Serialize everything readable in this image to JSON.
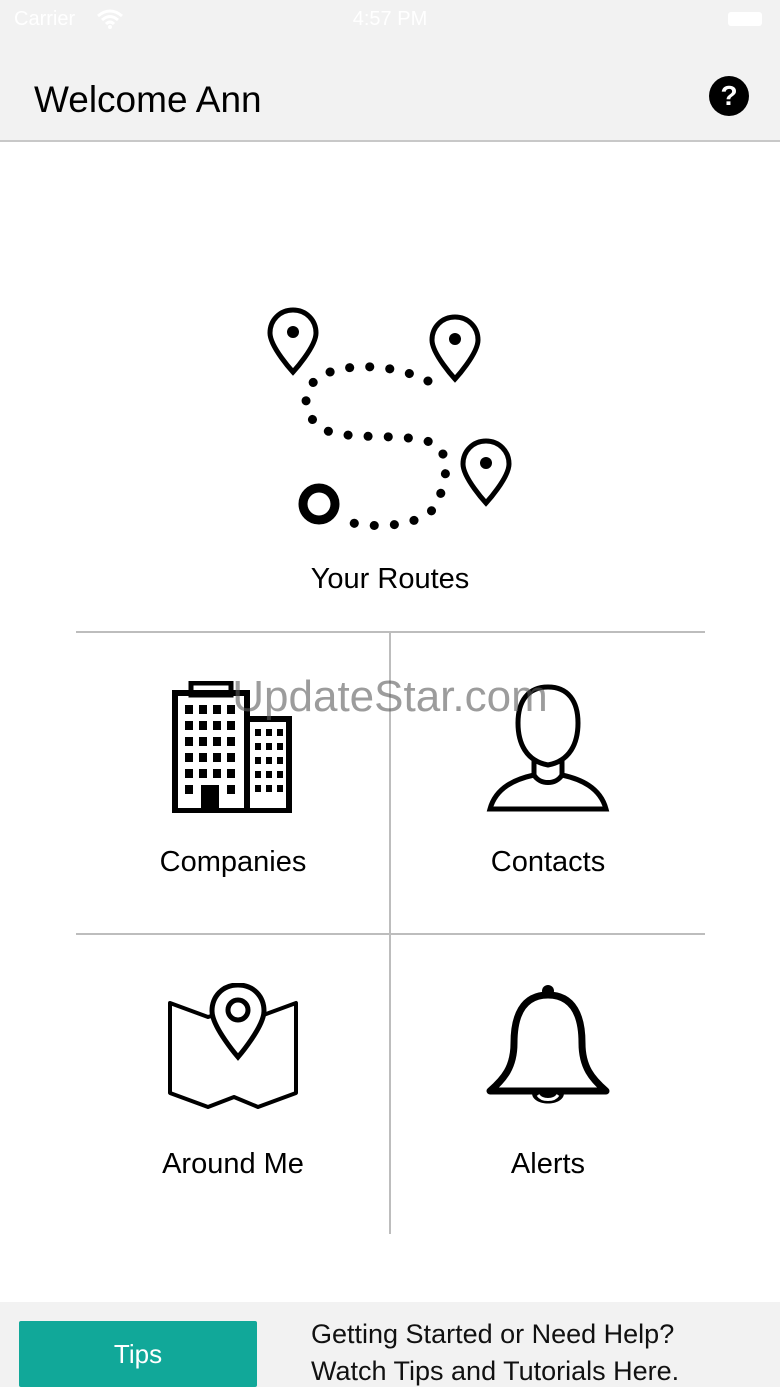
{
  "status_bar": {
    "carrier": "Carrier",
    "time": "4:57 PM",
    "wifi_icon": "wifi-icon",
    "battery_icon": "battery-icon"
  },
  "header": {
    "title": "Welcome Ann",
    "help_label": "?",
    "help_icon": "question-circle-icon"
  },
  "routes": {
    "label": "Your Routes",
    "icon": "route-map-icon"
  },
  "tiles": [
    {
      "label": "Companies",
      "icon": "buildings-icon"
    },
    {
      "label": "Contacts",
      "icon": "person-icon"
    },
    {
      "label": "Around Me",
      "icon": "map-pin-icon"
    },
    {
      "label": "Alerts",
      "icon": "bell-icon"
    }
  ],
  "watermark": "UpdateStar.com",
  "banner": {
    "tips_label": "Tips",
    "text_line1": "Getting Started or Need Help?",
    "text_line2": "Watch Tips and Tutorials Here."
  },
  "colors": {
    "accent": "#11a899",
    "header_bg": "#f2f2f2",
    "divider": "#bdbdbd"
  }
}
